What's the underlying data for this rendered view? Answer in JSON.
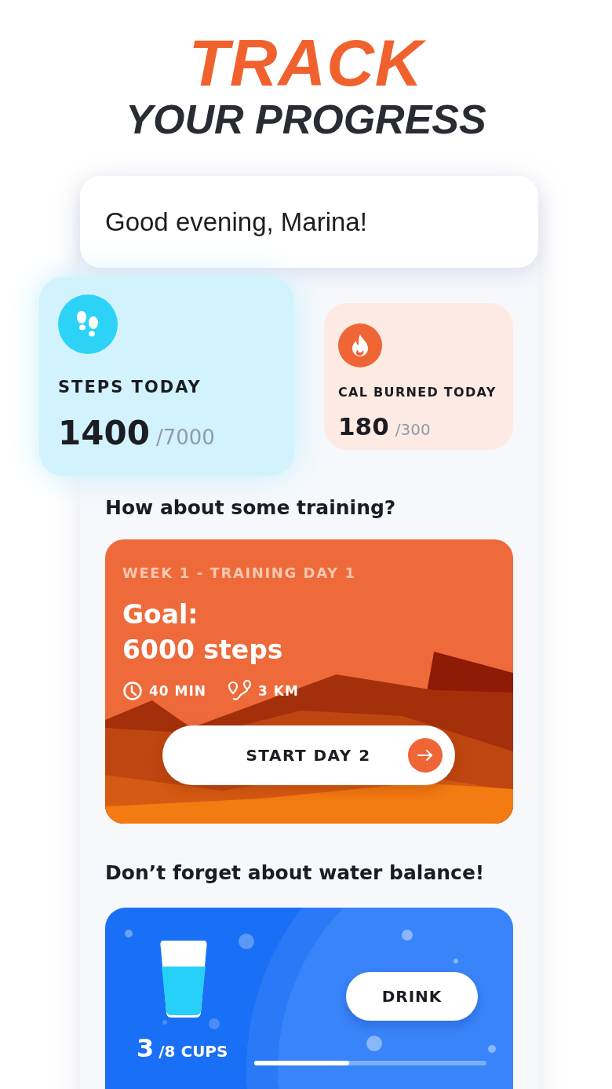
{
  "headline": {
    "title": "TRACK",
    "subtitle": "YOUR PROGRESS"
  },
  "greeting": "Good evening, Marina!",
  "stats": [
    {
      "kind": "steps",
      "label": "STEPS TODAY",
      "value": "1400",
      "goal": "/7000"
    },
    {
      "kind": "calories",
      "label": "CAL BURNED TODAY",
      "value": "180",
      "goal": "/300"
    }
  ],
  "training": {
    "heading": "How about some training?",
    "week": "WEEK 1 - TRAINING DAY 1",
    "goal_line_1": "Goal:",
    "goal_line_2": "6000 steps",
    "duration": "40 MIN",
    "distance": "3 KM",
    "button": "START DAY 2"
  },
  "water": {
    "heading": "Don’t forget about water balance!",
    "button": "DRINK",
    "count": "3",
    "total": "/8 CUPS",
    "level": 0.41
  }
}
